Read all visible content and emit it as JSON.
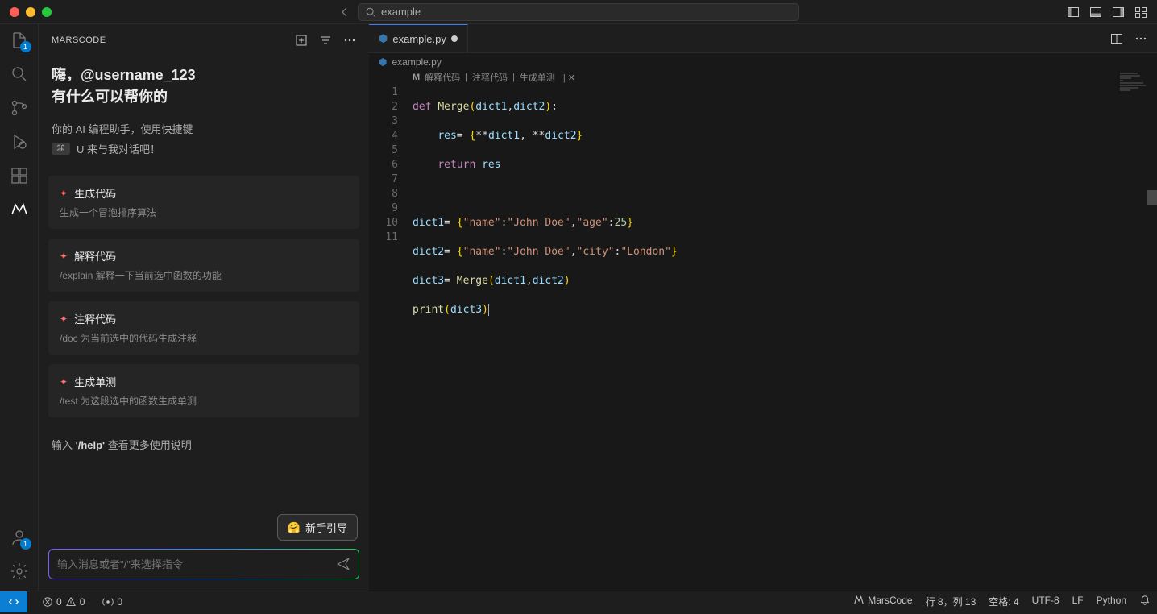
{
  "titlebar": {
    "search_text": "example"
  },
  "sidebar": {
    "title": "MARSCODE",
    "greeting_line1": "嗨，@username_123",
    "greeting_line2": "有什么可以帮你的",
    "sub_msg": "你的 AI 编程助手，使用快捷键",
    "shortcut_key": "⌘",
    "shortcut_text": "U 来与我对话吧！",
    "cards": [
      {
        "title": "生成代码",
        "desc": "生成一个冒泡排序算法"
      },
      {
        "title": "解释代码",
        "desc": "/explain 解释一下当前选中函数的功能"
      },
      {
        "title": "注释代码",
        "desc": "/doc 为当前选中的代码生成注释"
      },
      {
        "title": "生成单测",
        "desc": "/test 为这段选中的函数生成单测"
      }
    ],
    "help_hint_prefix": "输入 ",
    "help_hint_cmd": "'/help'",
    "help_hint_suffix": " 查看更多使用说明",
    "guide_btn": "新手引导",
    "input_placeholder": "输入消息或者\"/\"来选择指令"
  },
  "activity": {
    "explorer_badge": "1",
    "accounts_badge": "1"
  },
  "editor": {
    "tab_name": "example.py",
    "breadcrumb": "example.py",
    "codelens": {
      "a": "解释代码",
      "b": "注释代码",
      "c": "生成单测"
    },
    "line_numbers": [
      "1",
      "2",
      "3",
      "4",
      "5",
      "6",
      "7",
      "8",
      "9",
      "10",
      "11"
    ]
  },
  "status": {
    "errors": "0",
    "warnings": "0",
    "ports": "0",
    "brand": "MarsCode",
    "cursor_pos": "行 8，列 13",
    "spaces": "空格: 4",
    "encoding": "UTF-8",
    "eol": "LF",
    "lang": "Python"
  }
}
